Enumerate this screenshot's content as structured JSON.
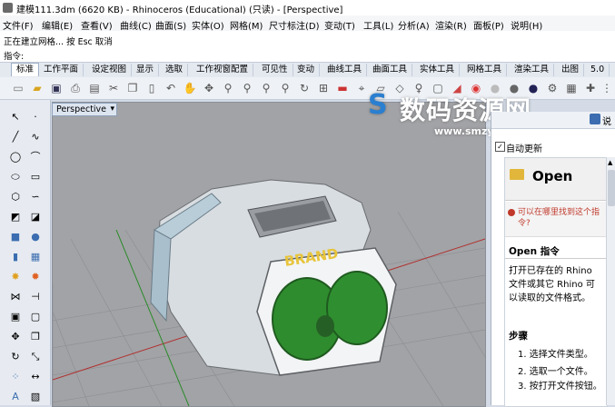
{
  "window": {
    "title": "建模111.3dm (6620 KB) - Rhinoceros (Educational) (只读) - [Perspective]"
  },
  "menu": [
    "文件(F)",
    "编辑(E)",
    "查看(V)",
    "曲线(C)",
    "曲面(S)",
    "实体(O)",
    "网格(M)",
    "尺寸标注(D)",
    "变动(T)",
    "工具(L)",
    "分析(A)",
    "渲染(R)",
    "面板(P)",
    "说明(H)"
  ],
  "command": {
    "line1": "正在建立网格... 按 Esc 取消",
    "prompt": "指令:"
  },
  "tabs": [
    "标准",
    "工作平面",
    "设定视图",
    "显示",
    "选取",
    "工作视窗配置",
    "可见性",
    "变动",
    "曲线工具",
    "曲面工具",
    "实体工具",
    "网格工具",
    "渲染工具",
    "出图",
    "5.0"
  ],
  "viewport": {
    "label": "Perspective",
    "dropdown": "▾",
    "model_text": "BRAND"
  },
  "watermark": {
    "main": "数码资源网",
    "url": "www.smzy.com"
  },
  "right_panel": {
    "tab_label": "说",
    "auto_update": "自动更新",
    "open_title": "Open",
    "link_text": "可以在哪里找到这个指令?",
    "section_title": "Open 指令",
    "description": "打开已存在的 Rhino 文件或其它 Rhino 可以读取的文件格式。",
    "steps_title": "步骤",
    "steps": [
      "1. 选择文件类型。",
      "2. 选取一个文件。",
      "3. 按打开文件按钮。"
    ],
    "step3_bold": "打开文件"
  },
  "colors": {
    "accent": "#3b6db0",
    "link_red": "#c0392b",
    "model_green": "#2e8c2e",
    "brand_yellow": "#e8c43a"
  }
}
